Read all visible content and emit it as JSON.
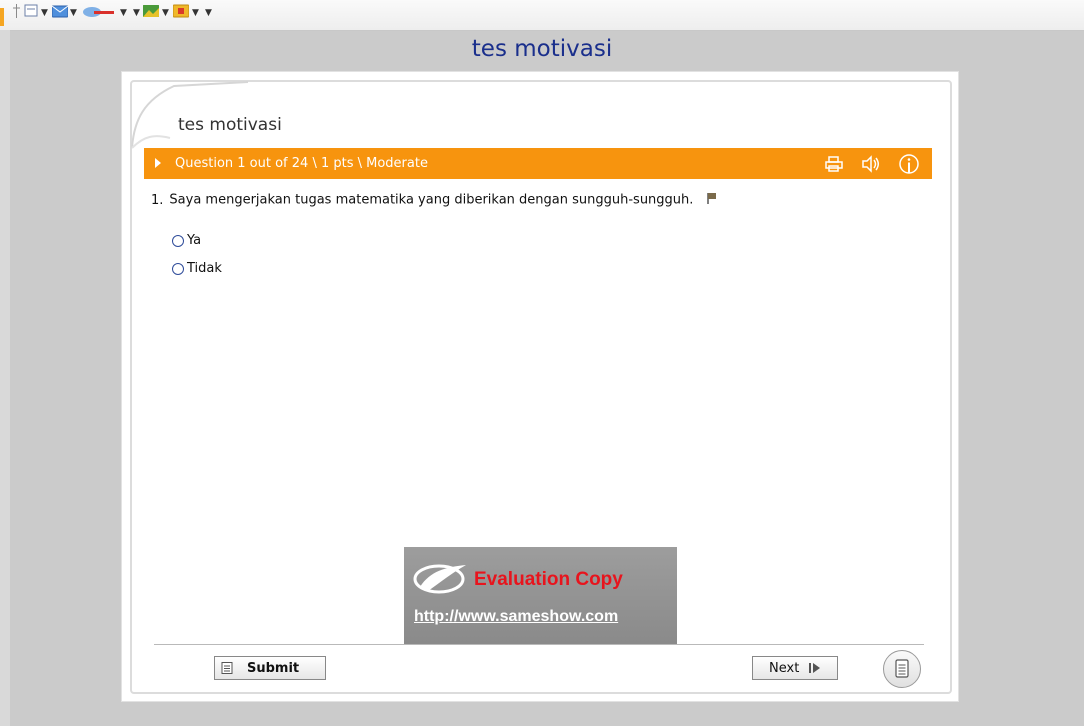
{
  "window": {
    "title": "tes motivasi"
  },
  "quiz": {
    "title": "tes motivasi",
    "question_header": "Question 1 out of 24 \\ 1 pts \\ Moderate",
    "question": {
      "number": "1.",
      "text": "Saya mengerjakan tugas matematika yang diberikan dengan sungguh-sungguh."
    },
    "choices": [
      "Ya",
      "Tidak"
    ]
  },
  "watermark": {
    "title": "Evaluation Copy",
    "url": "http://www.sameshow.com"
  },
  "footer": {
    "submit_label": "Submit",
    "next_label": "Next"
  },
  "icons": {
    "header": [
      "print-icon",
      "speaker-icon",
      "info-icon"
    ],
    "question": "flag-icon",
    "footer": [
      "submit-doc-icon",
      "next-arrow-icon",
      "review-list-icon"
    ]
  },
  "colors": {
    "accent": "#f7940e",
    "title_blue": "#1a2f8c",
    "watermark_red": "#e8141d",
    "background": "#cbcbcb"
  }
}
